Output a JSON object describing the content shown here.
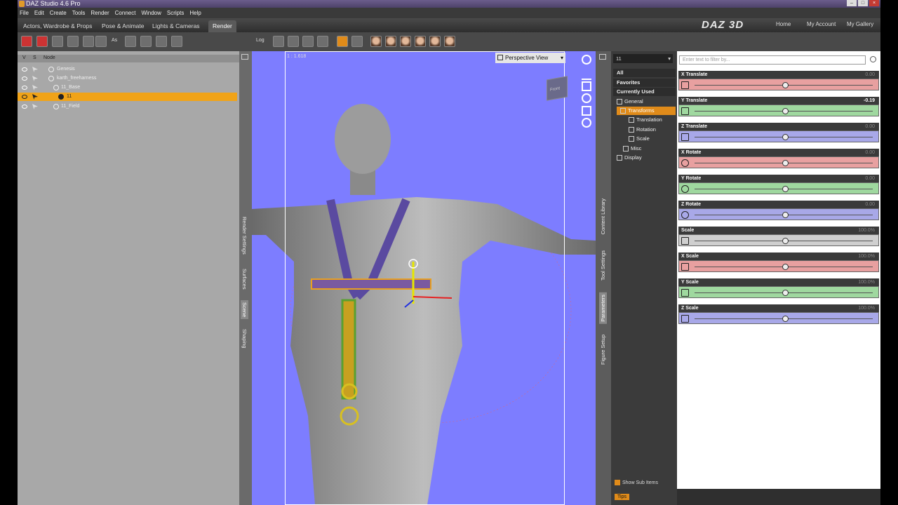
{
  "window": {
    "title": "DAZ Studio 4.6 Pro"
  },
  "menu": [
    "File",
    "Edit",
    "Create",
    "Tools",
    "Render",
    "Connect",
    "Window",
    "Scripts",
    "Help"
  ],
  "activity_tabs": [
    "Actors, Wardrobe & Props",
    "Pose & Animate",
    "Lights & Cameras",
    "Render"
  ],
  "brand": "DAZ 3D",
  "top_links": [
    "Home",
    "My Account",
    "My Gallery"
  ],
  "toolbar": {
    "label_a": "As",
    "label_b": "Log"
  },
  "scene": {
    "columns": [
      "V",
      "S",
      "Node"
    ],
    "nodes": [
      {
        "label": "Genesis"
      },
      {
        "label": "karth_freeharness"
      },
      {
        "label": "11_Base"
      },
      {
        "label": "11"
      },
      {
        "label": "11_Field"
      }
    ]
  },
  "scene_tabs": [
    "Render Settings",
    "Surfaces",
    "Scene",
    "Shaping"
  ],
  "viewport": {
    "ratio": "1 : 1.618",
    "view_label": "Perspective View",
    "cube_label": "Front"
  },
  "right_tabs": [
    "Content Library",
    "Tool Settings",
    "Parameters",
    "Figure Setup"
  ],
  "params": {
    "node_select": "11",
    "filter_placeholder": "Enter text to filter by...",
    "tree": [
      "All",
      "Favorites",
      "Currently Used",
      "General",
      "Transforms",
      "Translation",
      "Rotation",
      "Scale",
      "Misc",
      "Display"
    ],
    "show_sub_items": "Show Sub Items",
    "tips": "Tips",
    "rows": [
      {
        "label": "X Translate",
        "value": "0.00"
      },
      {
        "label": "Y Translate",
        "value": "-0.19"
      },
      {
        "label": "Z Translate",
        "value": "0.00"
      },
      {
        "label": "X Rotate",
        "value": "0.00"
      },
      {
        "label": "Y Rotate",
        "value": "0.00"
      },
      {
        "label": "Z Rotate",
        "value": "0.00"
      },
      {
        "label": "Scale",
        "value": "100.0%"
      },
      {
        "label": "X Scale",
        "value": "100.0%"
      },
      {
        "label": "Y Scale",
        "value": "100.0%"
      },
      {
        "label": "Z Scale",
        "value": "100.0%"
      }
    ]
  },
  "colors": {
    "accent": "#e08b1a",
    "x_axis": "#e8a0a0",
    "y_axis": "#9fd89f",
    "z_axis": "#a8a8e8",
    "neutral_axis": "#cfcfcf",
    "viewport_bg": "#7d7dff"
  }
}
